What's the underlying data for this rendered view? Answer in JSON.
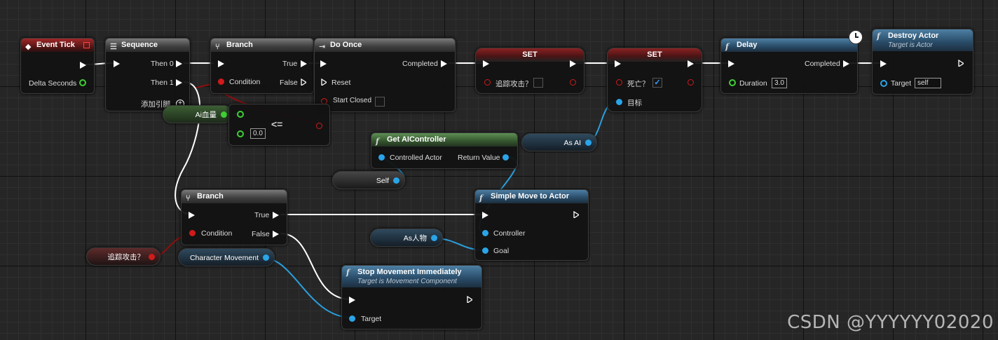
{
  "nodes": {
    "event_tick": {
      "title": "Event Tick",
      "delta_seconds": "Delta Seconds"
    },
    "sequence": {
      "title": "Sequence",
      "then0": "Then 0",
      "then1": "Then 1",
      "add_pin": "添加引脚"
    },
    "branch1": {
      "title": "Branch",
      "condition": "Condition",
      "true": "True",
      "false": "False"
    },
    "do_once": {
      "title": "Do Once",
      "completed": "Completed",
      "reset": "Reset",
      "start_closed": "Start Closed"
    },
    "set1": {
      "title": "SET",
      "var": "追踪攻击？"
    },
    "set2": {
      "title": "SET",
      "var": "死亡？",
      "target": "目标",
      "checkmark": "✓"
    },
    "delay": {
      "title": "Delay",
      "completed": "Completed",
      "duration": "Duration",
      "duration_value": "3.0"
    },
    "destroy_actor": {
      "title": "Destroy Actor",
      "subtitle": "Target is Actor",
      "target": "Target",
      "target_value": "self"
    },
    "ai_health_var": {
      "label": "Ai血量"
    },
    "compare": {
      "symbol": "<=",
      "value": "0.0"
    },
    "get_ai_controller": {
      "title": "Get AIController",
      "controlled_actor": "Controlled Actor",
      "return_value": "Return Value"
    },
    "as_ai": {
      "label": "As AI"
    },
    "self_var": {
      "label": "Self"
    },
    "branch2": {
      "title": "Branch",
      "condition": "Condition",
      "true": "True",
      "false": "False"
    },
    "simple_move": {
      "title": "Simple Move to Actor",
      "controller": "Controller",
      "goal": "Goal"
    },
    "as_person": {
      "label": "As人物"
    },
    "chase_var": {
      "label": "追踪攻击？"
    },
    "char_movement": {
      "label": "Character Movement"
    },
    "stop_movement": {
      "title": "Stop Movement Immediately",
      "subtitle": "Target is Movement Component",
      "target": "Target"
    }
  },
  "icons": {
    "event": "event-diamond-icon",
    "function": "function-f-icon",
    "clock": "latent-clock-icon",
    "branch": "branch-icon",
    "sequence": "sequence-icon"
  },
  "colors": {
    "exec_wire": "#ffffff",
    "bool_wire": "#8c0f0f",
    "object_wire": "#2a9fdd",
    "float_wire": "#3fcf35"
  },
  "watermark": "CSDN @YYYYYY02020"
}
